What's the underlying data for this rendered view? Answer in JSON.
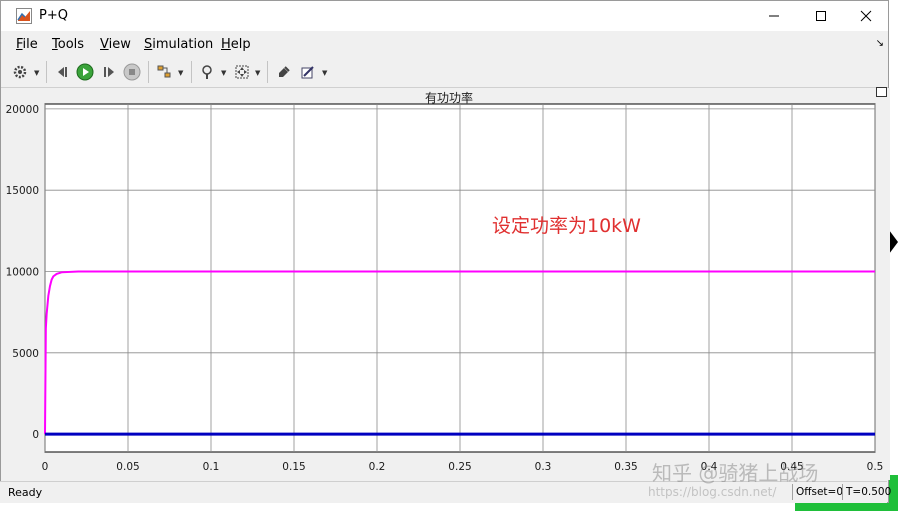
{
  "window": {
    "title": "P+Q"
  },
  "menu": [
    {
      "label": "File",
      "mnemonic": "F",
      "rest": "ile"
    },
    {
      "label": "Tools",
      "mnemonic": "T",
      "rest": "ools"
    },
    {
      "label": "View",
      "mnemonic": "V",
      "rest": "iew"
    },
    {
      "label": "Simulation",
      "mnemonic": "S",
      "rest": "imulation"
    },
    {
      "label": "Help",
      "mnemonic": "H",
      "rest": "elp"
    }
  ],
  "toolbar": {
    "icons": [
      "settings-icon",
      "step-back-icon",
      "run-icon",
      "step-forward-icon",
      "stop-icon",
      "signal-select-icon",
      "zoom-icon",
      "fit-axes-icon",
      "style-icon",
      "cursor-measure-icon"
    ]
  },
  "plot": {
    "title": "有功功率",
    "annotation": "设定功率为10kW"
  },
  "chart_data": {
    "type": "line",
    "title": "有功功率",
    "xlabel": "",
    "ylabel": "",
    "xlim": [
      0,
      0.5
    ],
    "ylim": [
      -1100,
      20300
    ],
    "xticks": [
      "0",
      "0.05",
      "0.1",
      "0.15",
      "0.2",
      "0.25",
      "0.3",
      "0.35",
      "0.4",
      "0.45",
      "0.5"
    ],
    "yticks": [
      "0",
      "5000",
      "10000",
      "15000",
      "20000"
    ],
    "grid": true,
    "series": [
      {
        "color": "#ff00ff",
        "x": [
          0,
          0.0005,
          0.001,
          0.002,
          0.003,
          0.004,
          0.005,
          0.007,
          0.01,
          0.02,
          0.05,
          0.1,
          0.2,
          0.3,
          0.4,
          0.5
        ],
        "y": [
          0,
          6500,
          7400,
          8500,
          9100,
          9500,
          9700,
          9850,
          9950,
          10000,
          10000,
          10000,
          10000,
          10000,
          10000,
          10000
        ]
      },
      {
        "color": "#0000c0",
        "x": [
          0,
          0.5
        ],
        "y": [
          0,
          0
        ]
      }
    ]
  },
  "status": {
    "text": "Ready",
    "offset": "Offset=0",
    "time": "T=0.500"
  },
  "watermark": {
    "text": "知乎 @骑猪上战场",
    "url": "https://blog.csdn.net/"
  }
}
